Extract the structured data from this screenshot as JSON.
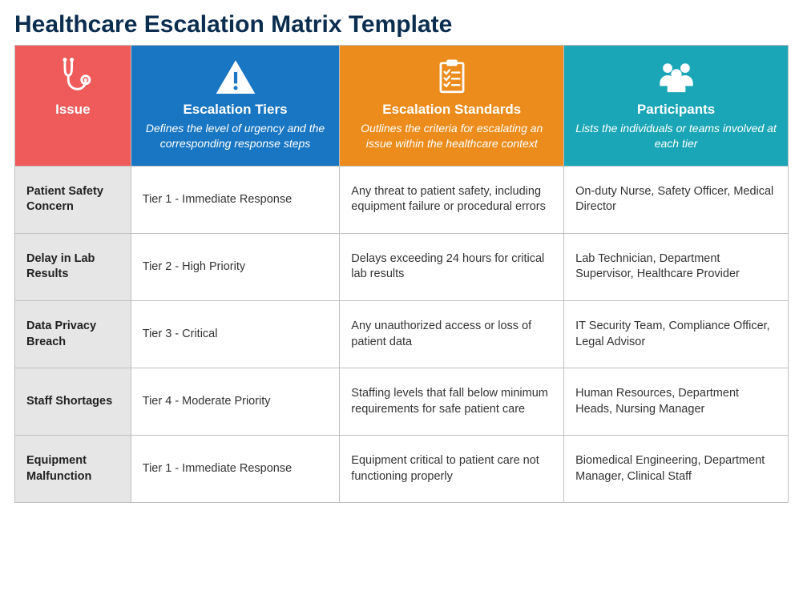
{
  "title": "Healthcare Escalation Matrix Template",
  "headers": {
    "issue": {
      "label": "Issue",
      "subtitle": ""
    },
    "tiers": {
      "label": "Escalation Tiers",
      "subtitle": "Defines the level of urgency and the corresponding response steps"
    },
    "standards": {
      "label": "Escalation Standards",
      "subtitle": "Outlines the criteria for escalating an issue within the healthcare context"
    },
    "participants": {
      "label": "Participants",
      "subtitle": "Lists the individuals or teams involved at each tier"
    }
  },
  "rows": [
    {
      "issue": "Patient Safety Concern",
      "tier": "Tier 1 - Immediate Response",
      "standard": "Any threat to patient safety, including equipment failure or procedural errors",
      "participants": "On-duty Nurse, Safety Officer, Medical Director"
    },
    {
      "issue": "Delay in Lab Results",
      "tier": "Tier 2 - High Priority",
      "standard": "Delays exceeding 24 hours for critical lab results",
      "participants": "Lab Technician, Department Supervisor, Healthcare Provider"
    },
    {
      "issue": "Data Privacy Breach",
      "tier": "Tier 3 - Critical",
      "standard": "Any unauthorized access or loss of patient data",
      "participants": "IT Security Team, Compliance Officer, Legal Advisor"
    },
    {
      "issue": "Staff Shortages",
      "tier": "Tier 4 - Moderate Priority",
      "standard": "Staffing levels that fall below minimum requirements for safe patient care",
      "participants": "Human Resources, Department Heads, Nursing Manager"
    },
    {
      "issue": "Equipment Malfunction",
      "tier": "Tier 1 - Immediate Response",
      "standard": "Equipment critical to patient care not functioning properly",
      "participants": "Biomedical Engineering, Department Manager, Clinical Staff"
    }
  ]
}
